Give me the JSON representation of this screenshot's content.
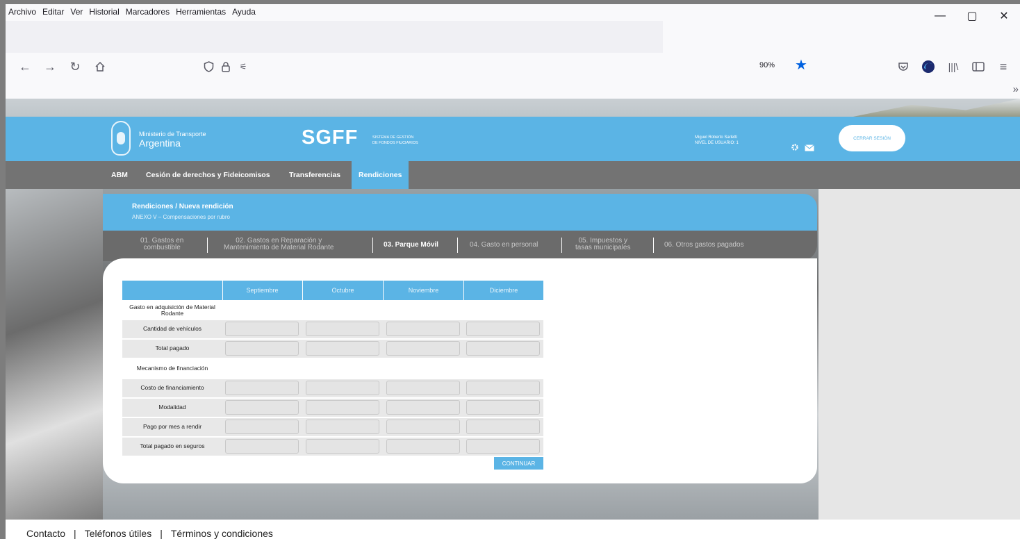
{
  "browser": {
    "menu": [
      "Archivo",
      "Editar",
      "Ver",
      "Historial",
      "Marcadores",
      "Herramientas",
      "Ayuda"
    ],
    "window_controls": [
      "—",
      "▢",
      "✕"
    ],
    "zoom": "90%",
    "nav_icons": [
      "back-icon",
      "forward-icon",
      "reload-icon",
      "home-icon",
      "shield-icon",
      "lock-icon",
      "permissions-icon"
    ],
    "toolbar_icons": [
      "pocket-icon",
      "account-icon",
      "library-icon",
      "sidebar-icon",
      "menu-icon"
    ],
    "overflow": "»"
  },
  "site": {
    "ministry_small": "Ministerio de Transporte",
    "ministry_big": "Argentina",
    "brand": "SGFF",
    "brand_sub_1": "SISTEMA DE GESTIÓN",
    "brand_sub_2": "DE FONDOS FIUCIARIOS",
    "user_name": "Miguel Roberto Sarletti",
    "user_level": "NIVEL DE USUARIO: 1",
    "logout": "CERRAR SESIÓN",
    "nav": [
      "ABM",
      "Cesión de derechos y Fideicomisos",
      "Transferencias",
      "Rendiciones"
    ]
  },
  "panel": {
    "breadcrumb": "Rendiciones / Nueva rendición",
    "subtitle": "ANEXO V – Compensaciones por rubro",
    "tabs": [
      {
        "line1": "01. Gastos en",
        "line2": "combustible"
      },
      {
        "line1": "02. Gastos en Reparación y",
        "line2": "Mantenimiento de Material Rodante"
      },
      {
        "line1": "03. Parque Móvil",
        "line2": ""
      },
      {
        "line1": "04. Gasto en personal",
        "line2": ""
      },
      {
        "line1": "05. Impuestos y",
        "line2": "tasas municipales"
      },
      {
        "line1": "06. Otros gastos pagados",
        "line2": ""
      }
    ]
  },
  "table": {
    "columns": [
      "Septiembre",
      "Octubre",
      "Noviembre",
      "Diciembre"
    ],
    "rows": [
      {
        "label": "Gasto en adquisición de Material Rodante",
        "inputs": false
      },
      {
        "label": "Cantidad de vehículos",
        "inputs": true
      },
      {
        "label": "Total pagado",
        "inputs": true
      },
      {
        "label": "Mecanismo de financiación",
        "inputs": false
      },
      {
        "label": "Costo de financiamiento",
        "inputs": true
      },
      {
        "label": "Modalidad",
        "inputs": true
      },
      {
        "label": "Pago por mes a rendir",
        "inputs": true
      },
      {
        "label": "Total pagado en seguros",
        "inputs": true
      }
    ],
    "continue": "CONTINUAR"
  },
  "footer": {
    "links": [
      "Contacto",
      "Teléfonos útiles",
      "Términos y condiciones"
    ],
    "separator": "|"
  }
}
